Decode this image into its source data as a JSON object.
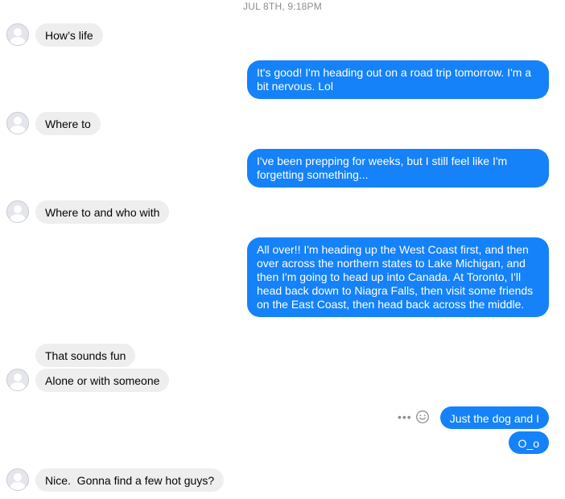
{
  "thread": {
    "timestamp": "JUL 8TH, 9:18PM"
  },
  "messages": [
    {
      "from": "them",
      "text": "How’s life"
    },
    {
      "from": "me",
      "text": "It's good! I'm heading out on a road trip tomorrow. I'm a bit nervous. Lol"
    },
    {
      "from": "them",
      "text": "Where to"
    },
    {
      "from": "me",
      "text": "I've been prepping for weeks, but I still feel like I'm forgetting something..."
    },
    {
      "from": "them",
      "text": "Where to and who with"
    },
    {
      "from": "me",
      "text": "All over!! I'm heading up the West Coast first, and then over across the northern states to Lake Michigan, and then I'm going to head up into Canada. At Toronto, I'll head back down to Niagra Falls, then visit some friends on the East Coast, then head back across the middle."
    },
    {
      "from": "them",
      "text": "That sounds fun"
    },
    {
      "from": "them",
      "text": "Alone or with someone"
    },
    {
      "from": "me",
      "text": "Just the dog and I"
    },
    {
      "from": "me",
      "text": "O_o"
    },
    {
      "from": "them",
      "text": "Nice.  Gonna find a few hot guys?"
    }
  ],
  "icons": {
    "avatar": "default-avatar-icon",
    "more": "more-dots-icon",
    "react": "emoji-smile-icon"
  },
  "colors": {
    "outgoing_bubble": "#1582f9",
    "incoming_bubble": "#eeeeee",
    "timestamp": "#8a8d91"
  }
}
